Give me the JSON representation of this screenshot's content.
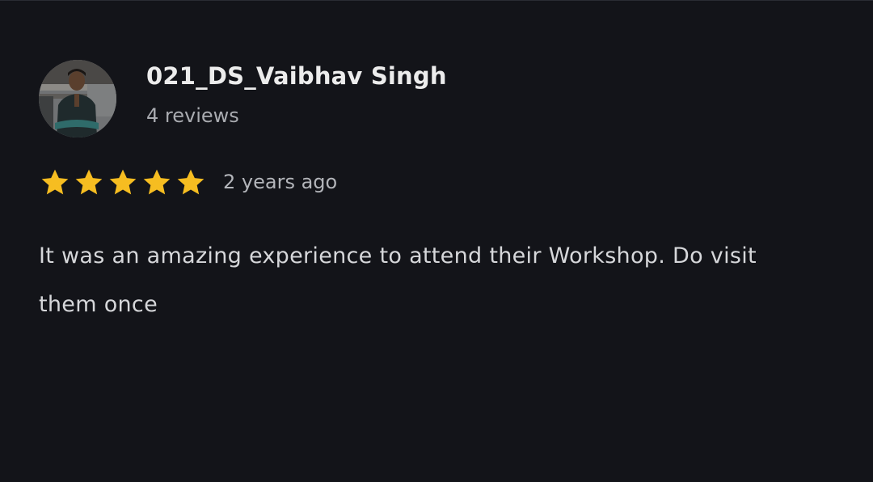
{
  "review": {
    "author_name": "021_DS_Vaibhav Singh",
    "author_reviews": "4 reviews",
    "avatar_icon": "user-photo-avatar",
    "rating": 5,
    "rating_max": 5,
    "star_color": "#f6bd21",
    "time_ago": "2 years ago",
    "text": "It was an amazing experience to attend their Workshop. Do visit them once"
  }
}
